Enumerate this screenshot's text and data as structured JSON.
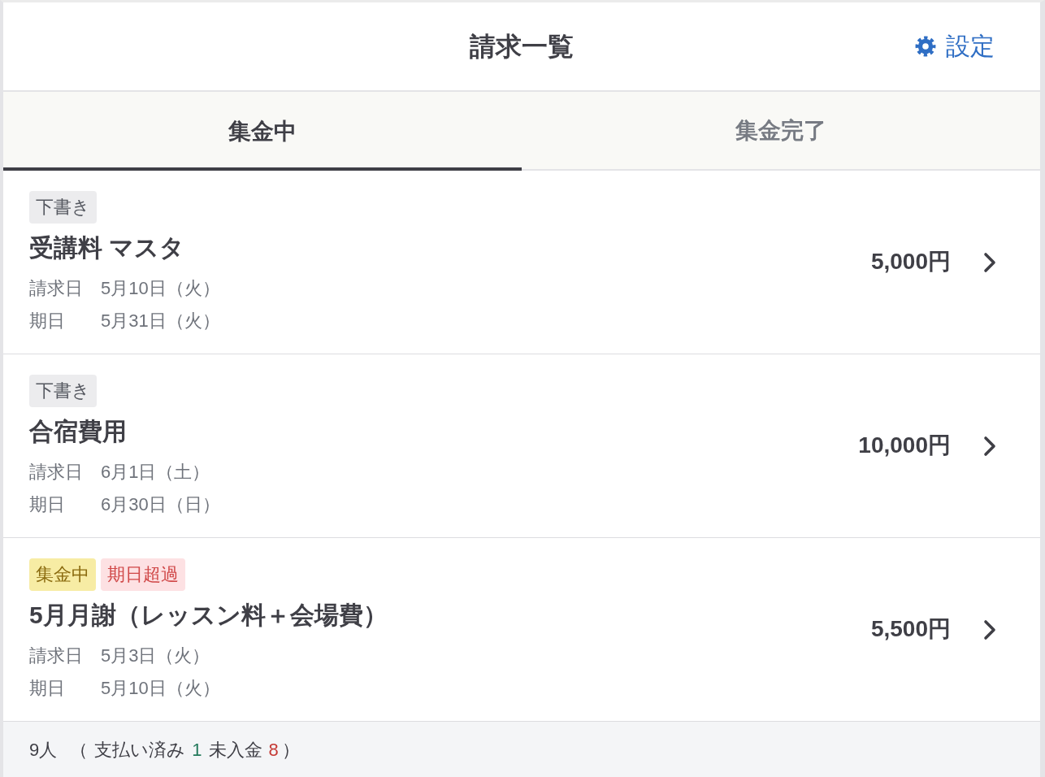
{
  "header": {
    "title": "請求一覧",
    "settings": {
      "label": "設定"
    }
  },
  "tabs": [
    {
      "label": "集金中",
      "selected": true
    },
    {
      "label": "集金完了",
      "selected": false
    }
  ],
  "invoices": [
    {
      "badges": [
        {
          "label": "下書き",
          "kind": "draft"
        }
      ],
      "title": "受講料 マスタ",
      "dates": [
        {
          "label": "請求日",
          "value": "5月10日（火）"
        },
        {
          "label": "期日",
          "value": "5月31日（火）"
        }
      ],
      "amount": "5,000円"
    },
    {
      "badges": [
        {
          "label": "下書き",
          "kind": "draft"
        }
      ],
      "title": "合宿費用",
      "dates": [
        {
          "label": "請求日",
          "value": "6月1日（土）"
        },
        {
          "label": "期日",
          "value": "6月30日（日）"
        }
      ],
      "amount": "10,000円"
    },
    {
      "badges": [
        {
          "label": "集金中",
          "kind": "collecting"
        },
        {
          "label": "期日超過",
          "kind": "overdue"
        }
      ],
      "title": "5月月謝（レッスン料＋会場費）",
      "dates": [
        {
          "label": "請求日",
          "value": "5月3日（火）"
        },
        {
          "label": "期日",
          "value": "5月10日（火）"
        }
      ],
      "amount": "5,500円"
    }
  ],
  "summary": {
    "total": "9人",
    "open": "（",
    "paid_label": "支払い済み",
    "paid_count": "1",
    "unpaid_label": "未入金",
    "unpaid_count": "8",
    "close": "）"
  }
}
